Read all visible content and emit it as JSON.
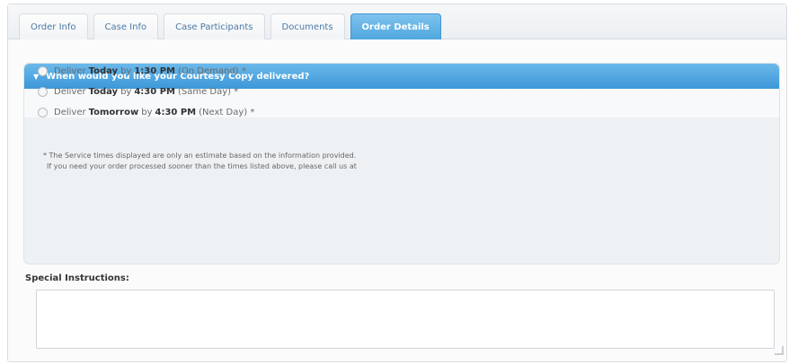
{
  "tabs": [
    {
      "label": "Order Info",
      "active": false
    },
    {
      "label": "Case Info",
      "active": false
    },
    {
      "label": "Case Participants",
      "active": false
    },
    {
      "label": "Documents",
      "active": false
    },
    {
      "label": "Order Details",
      "active": true
    }
  ],
  "delivery": {
    "header": "When would you like your Courtesy Copy delivered?",
    "options": [
      {
        "prefix": "Deliver",
        "day": "Today",
        "by": "by",
        "time": "1:30 PM",
        "suffix": "(On Demand) *"
      },
      {
        "prefix": "Deliver",
        "day": "Today",
        "by": "by",
        "time": "4:30 PM",
        "suffix": "(Same Day) *"
      },
      {
        "prefix": "Deliver",
        "day": "Tomorrow",
        "by": "by",
        "time": "4:30 PM",
        "suffix": "(Next Day) *"
      }
    ],
    "note_line1": "* The Service times displayed are only an estimate based on the information provided.",
    "note_line2": "If you need your order processed sooner than the times listed above, please call us at"
  },
  "special_instructions": {
    "label": "Special Instructions:",
    "value": ""
  },
  "colors": {
    "accent": "#4fa6de",
    "tab_text": "#4c79a8"
  }
}
